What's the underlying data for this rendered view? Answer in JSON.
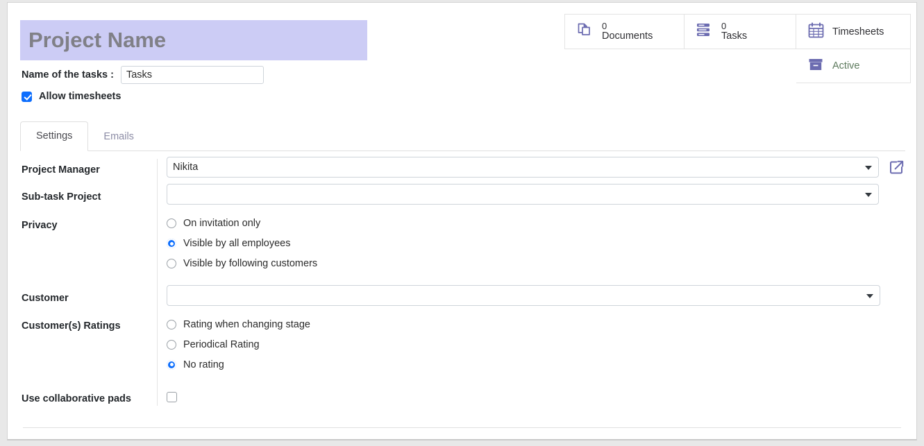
{
  "header": {
    "project_name_value": "Project Name",
    "project_name_placeholder": "Project Name",
    "tasks_label": "Name of the tasks :",
    "tasks_value": "Tasks",
    "tasks_placeholder": "Tasks",
    "allow_timesheets_label": "Allow timesheets",
    "allow_timesheets_checked": true
  },
  "stats": [
    {
      "name": "documents",
      "count": "0",
      "label": "Documents",
      "icon": "documents-icon"
    },
    {
      "name": "tasks",
      "count": "0",
      "label": "Tasks",
      "icon": "tasks-list-icon"
    },
    {
      "name": "timesheets",
      "label": "Timesheets",
      "icon": "calendar-icon"
    },
    {
      "name": "active",
      "label": "Active",
      "icon": "archive-box-icon"
    }
  ],
  "tabs": [
    {
      "label": "Settings",
      "active": true
    },
    {
      "label": "Emails",
      "active": false
    }
  ],
  "form": {
    "project_manager": {
      "label": "Project Manager",
      "value": "Nikita",
      "external_link_icon": "external-link-icon"
    },
    "sub_task_project": {
      "label": "Sub-task Project",
      "value": ""
    },
    "privacy": {
      "label": "Privacy",
      "options": [
        {
          "label": "On invitation only",
          "selected": false
        },
        {
          "label": "Visible by all employees",
          "selected": true
        },
        {
          "label": "Visible by following customers",
          "selected": false
        }
      ]
    },
    "customer": {
      "label": "Customer",
      "value": ""
    },
    "customer_ratings": {
      "label": "Customer(s) Ratings",
      "options": [
        {
          "label": "Rating when changing stage",
          "selected": false
        },
        {
          "label": "Periodical Rating",
          "selected": false
        },
        {
          "label": "No rating",
          "selected": true
        }
      ]
    },
    "collaborative_pads": {
      "label": "Use collaborative pads",
      "checked": false
    }
  },
  "colors": {
    "title_field_bg": "#ccccf5",
    "accent_blue": "#0d6efd",
    "icon_purple": "#6b6bb0",
    "active_green": "#5d7a5d"
  }
}
